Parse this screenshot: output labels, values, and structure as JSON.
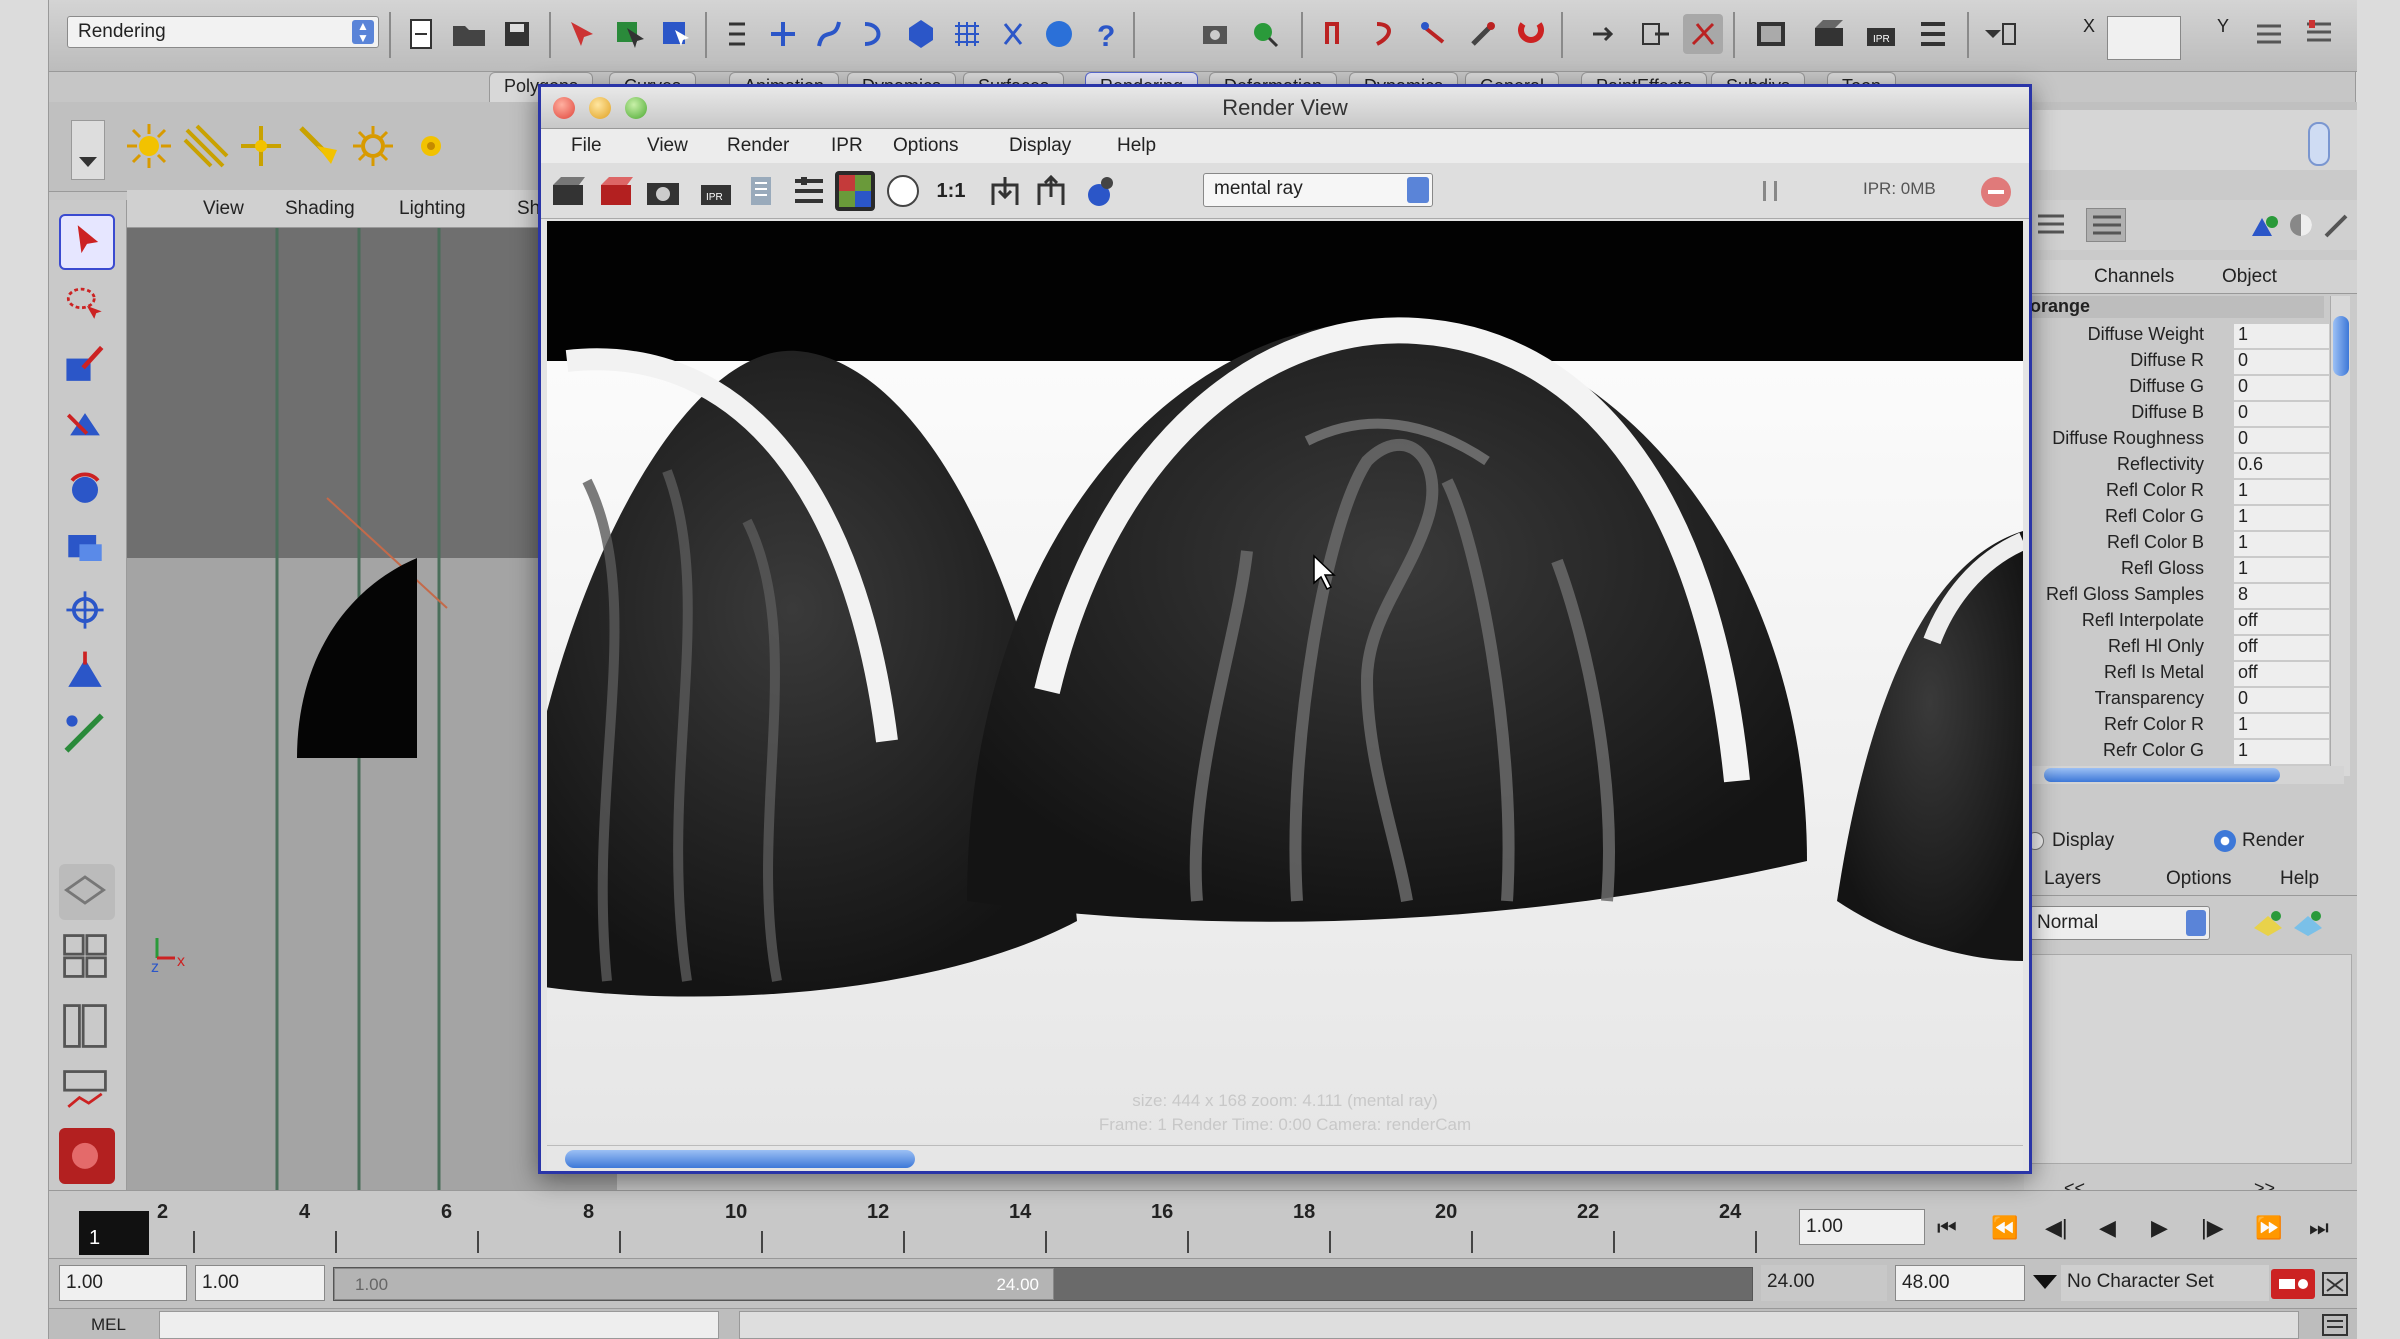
{
  "menu_set": "Rendering",
  "shelf_tabs": [
    "Polygons",
    "Curves",
    "Animation",
    "Dynamics",
    "Surfaces",
    "Rendering",
    "Deformation",
    "Dynamics",
    "General",
    "PaintEffects",
    "Subdivs",
    "Toon"
  ],
  "viewport_menu": [
    "View",
    "Shading",
    "Lighting",
    "Show"
  ],
  "render_view": {
    "title": "Render View",
    "menu": [
      "File",
      "View",
      "Render",
      "IPR",
      "Options",
      "Display",
      "Help"
    ],
    "renderer": "mental ray",
    "ratio_label": "1:1",
    "ipr_status": "IPR: 0MB",
    "info_line1": "size: 444 x 168 zoom: 4.111      (mental ray)",
    "info_line2": "Frame: 1      Render Time: 0:00      Camera: renderCam"
  },
  "channel_box": {
    "tabs": [
      "Channels",
      "Object"
    ],
    "node_name": "orange",
    "attributes": [
      {
        "name": "Diffuse Weight",
        "value": "1"
      },
      {
        "name": "Diffuse R",
        "value": "0"
      },
      {
        "name": "Diffuse G",
        "value": "0"
      },
      {
        "name": "Diffuse B",
        "value": "0"
      },
      {
        "name": "Diffuse Roughness",
        "value": "0"
      },
      {
        "name": "Reflectivity",
        "value": "0.6"
      },
      {
        "name": "Refl Color R",
        "value": "1"
      },
      {
        "name": "Refl Color G",
        "value": "1"
      },
      {
        "name": "Refl Color B",
        "value": "1"
      },
      {
        "name": "Refl Gloss",
        "value": "1"
      },
      {
        "name": "Refl Gloss Samples",
        "value": "8"
      },
      {
        "name": "Refl Interpolate",
        "value": "off"
      },
      {
        "name": "Refl Hl Only",
        "value": "off"
      },
      {
        "name": "Refl Is Metal",
        "value": "off"
      },
      {
        "name": "Transparency",
        "value": "0"
      },
      {
        "name": "Refr Color R",
        "value": "1"
      },
      {
        "name": "Refr Color G",
        "value": "1"
      }
    ]
  },
  "layers": {
    "modes": [
      "Display",
      "Render"
    ],
    "selected_mode": "Render",
    "menu": [
      "Layers",
      "Options",
      "Help"
    ],
    "blend": "Normal"
  },
  "timeline": {
    "ticks": [
      "2",
      "4",
      "6",
      "8",
      "10",
      "12",
      "14",
      "16",
      "18",
      "20",
      "22",
      "24"
    ],
    "current_frame_box": "1",
    "current_time": "1.00"
  },
  "range": {
    "start": "1.00",
    "playback_start": "1.00",
    "playback_end": "24.00",
    "end": "48.00",
    "slider_left": "1.00",
    "slider_right": "24.00",
    "character_set": "No Character Set"
  },
  "command_line": {
    "label": "MEL"
  },
  "colors": {
    "render_view_border": "#2a35a8",
    "accent_blue": "#3d78d8"
  }
}
